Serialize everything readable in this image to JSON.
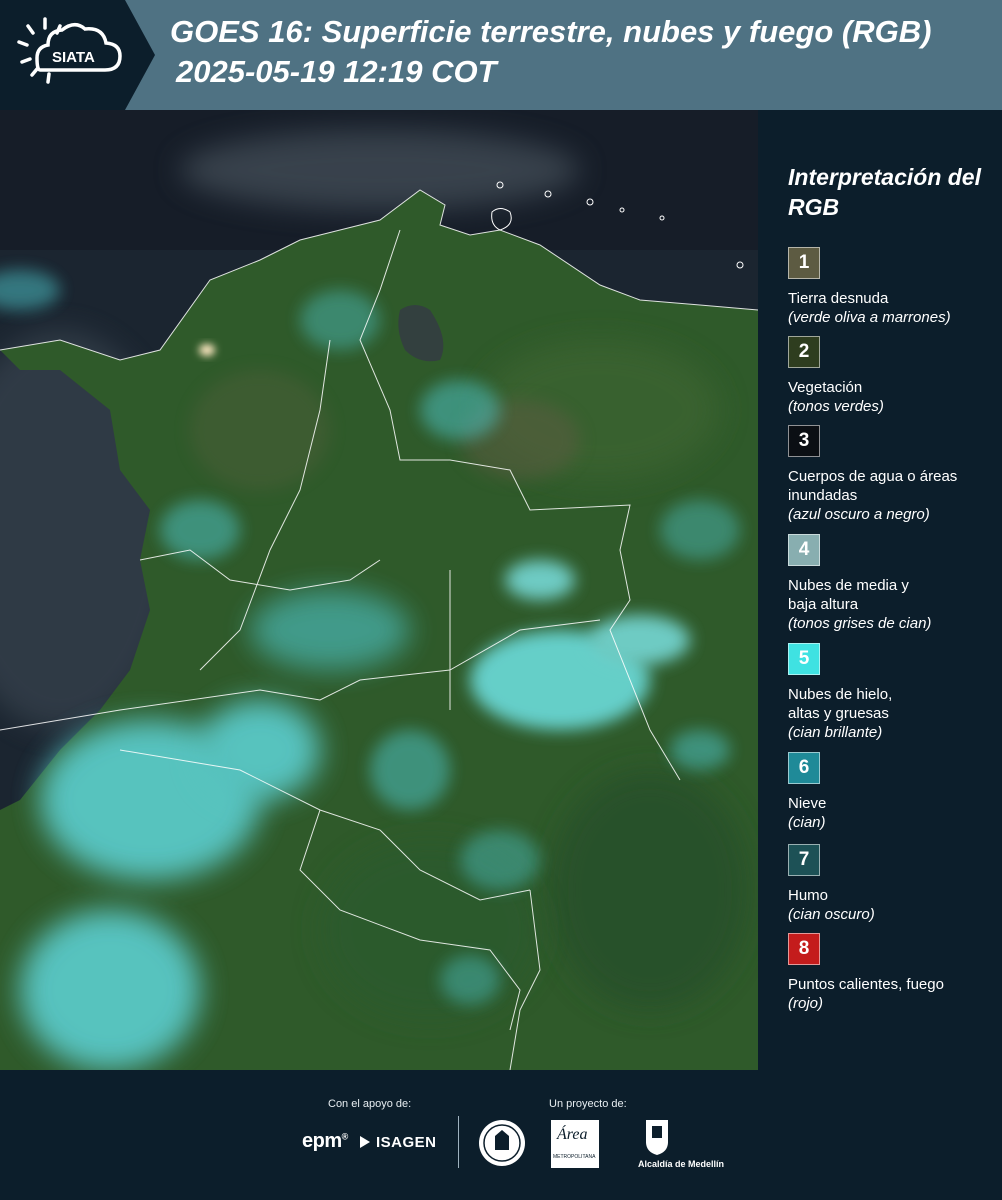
{
  "header": {
    "logo_text": "SIATA",
    "title_line1": "GOES 16: Superficie terrestre, nubes y fuego (RGB)",
    "title_line2": "2025-05-19 12:19 COT"
  },
  "legend": {
    "title": "Interpretación del RGB",
    "items": [
      {
        "number": "1",
        "color": "#5d5b42",
        "label": "Tierra desnuda",
        "sub": "(verde oliva a marrones)"
      },
      {
        "number": "2",
        "color": "#2e3d1f",
        "label": "Vegetación",
        "sub": "(tonos verdes)"
      },
      {
        "number": "3",
        "color": "#0b0f14",
        "label": "Cuerpos de agua o áreas inundadas",
        "sub": "(azul oscuro a negro)"
      },
      {
        "number": "4",
        "color": "#88aeb0",
        "label": "Nubes de media y baja altura",
        "sub": "(tonos grises de cian)"
      },
      {
        "number": "5",
        "color": "#3fe2e2",
        "label": "Nubes de hielo, altas y gruesas",
        "sub": "(cian brillante)"
      },
      {
        "number": "6",
        "color": "#1f8a98",
        "label": "Nieve",
        "sub": "(cian)"
      },
      {
        "number": "7",
        "color": "#1d5156",
        "label": "Humo",
        "sub": "(cian oscuro)"
      },
      {
        "number": "8",
        "color": "#c41c1c",
        "label": "Puntos calientes, fuego",
        "sub": "(rojo)"
      }
    ]
  },
  "footer": {
    "support_caption": "Con el apoyo de:",
    "project_caption": "Un proyecto de:",
    "sponsor1": "epm",
    "sponsor2": "ISAGEN",
    "partner_area": "Área",
    "partner_area_sub": "METROPOLITANA",
    "partner_alcaldia": "Alcaldía de Medellín"
  },
  "colors": {
    "header_bg": "#4f7283",
    "panel_bg": "#0c1e2b",
    "ocean": "#1b2530",
    "vegetation": "#2f5a2a",
    "cloud_ice": "#5ad8da"
  }
}
